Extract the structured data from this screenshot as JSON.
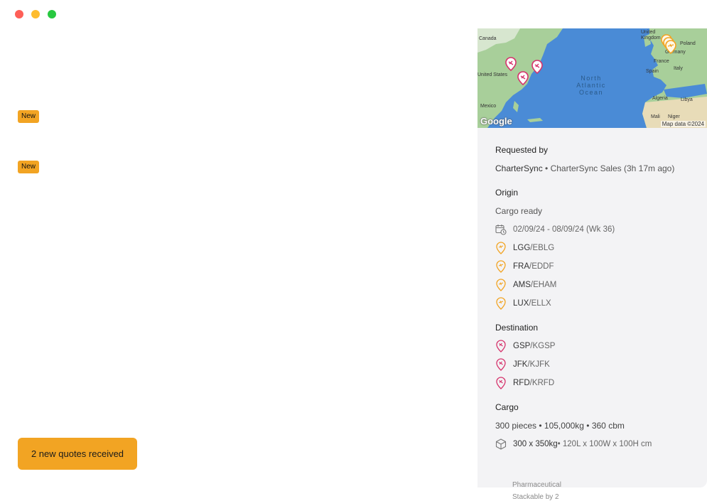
{
  "window": {
    "controls": [
      "close",
      "minimize",
      "maximize"
    ]
  },
  "badges": [
    "New",
    "New"
  ],
  "cta": {
    "label": "2 new quotes received"
  },
  "map": {
    "ocean_label_lines": [
      "North",
      "Atlantic",
      "Ocean"
    ],
    "place_labels": {
      "canada": "Canada",
      "united_states": "United States",
      "mexico": "Mexico",
      "united_kingdom": "United Kingdom",
      "poland": "Poland",
      "germany": "Germany",
      "france": "France",
      "spain": "Spain",
      "italy": "Italy",
      "algeria": "Algeria",
      "libya": "Libya",
      "mali": "Mali",
      "niger": "Niger"
    },
    "logo": "Google",
    "attribution": "Map data ©2024"
  },
  "requested_by": {
    "heading": "Requested by",
    "company": "CharterSync",
    "separator": "•",
    "detail": "CharterSync Sales (3h 17m ago)"
  },
  "origin": {
    "heading": "Origin",
    "cargo_ready": "Cargo ready",
    "date_range": "02/09/24 - 08/09/24 (Wk 36)",
    "airports": [
      {
        "iata": "LGG",
        "icao": "/EBLG"
      },
      {
        "iata": "FRA",
        "icao": "/EDDF"
      },
      {
        "iata": "AMS",
        "icao": "/EHAM"
      },
      {
        "iata": "LUX",
        "icao": "/ELLX"
      }
    ]
  },
  "destination": {
    "heading": "Destination",
    "airports": [
      {
        "iata": "GSP",
        "icao": "/KGSP"
      },
      {
        "iata": "JFK",
        "icao": "/KJFK"
      },
      {
        "iata": "RFD",
        "icao": "/KRFD"
      }
    ]
  },
  "cargo": {
    "heading": "Cargo",
    "summary": "300 pieces • 105,000kg • 360 cbm",
    "item_main": "300 x 350kg",
    "item_dims": " • 120L x 100W x 100H cm",
    "item_type": "Pharmaceutical",
    "item_stack": "Stackable by 2"
  },
  "colors": {
    "accent": "#f2a423",
    "origin_pin": "#f2a423",
    "destination_pin": "#d6336c",
    "panel_bg": "#f3f3f5",
    "ocean": "#4a8bd6",
    "land": "#a8cf9a"
  },
  "icons": {
    "calendar": "calendar-clock-icon",
    "origin": "departure-pin-icon",
    "destination": "arrival-pin-icon",
    "box": "box-icon"
  }
}
